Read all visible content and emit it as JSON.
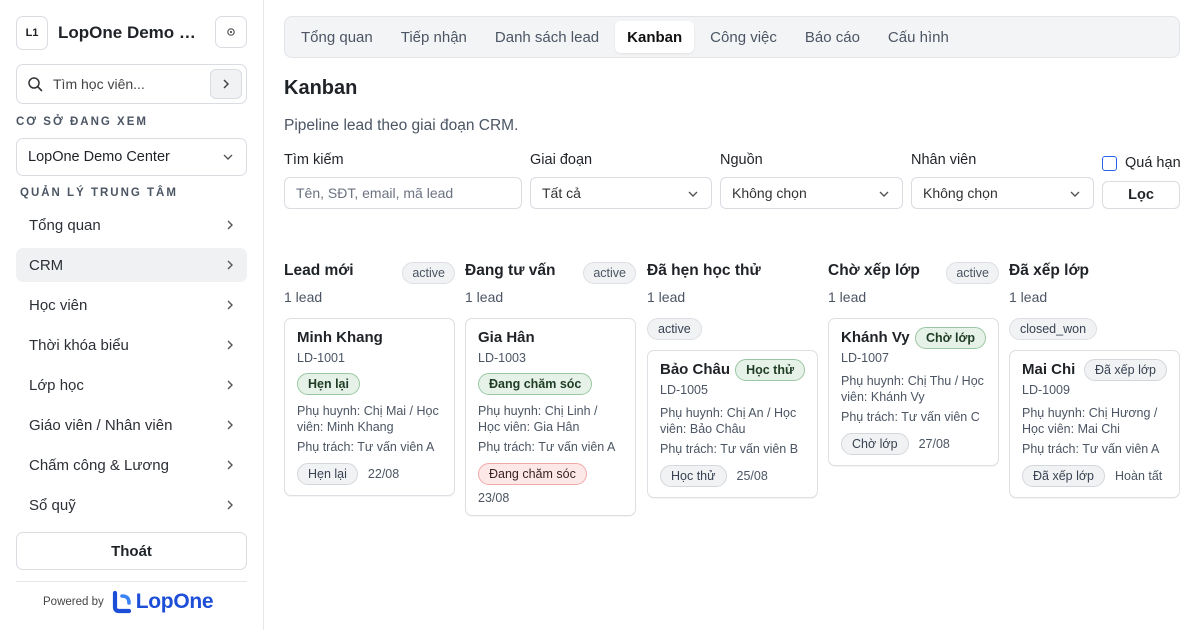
{
  "sidebar": {
    "logo_initials": "L1",
    "brand_name": "LopOne Demo Center",
    "search_placeholder": "Tìm học viên...",
    "center_section_label": "CƠ SỞ ĐANG XEM",
    "center_selected": "LopOne Demo Center",
    "manage_section_label": "QUẢN LÝ TRUNG TÂM",
    "nav_items": [
      {
        "label": "Tổng quan"
      },
      {
        "label": "CRM",
        "active": true
      },
      {
        "label": "Học viên"
      },
      {
        "label": "Thời khóa biểu"
      },
      {
        "label": "Lớp học"
      },
      {
        "label": "Giáo viên / Nhân viên"
      },
      {
        "label": "Chấm công & Lương"
      },
      {
        "label": "Sổ quỹ"
      }
    ],
    "logout_label": "Thoát",
    "powered_by": "Powered by",
    "powered_logo_text": "LopOne",
    "accent_color": "#1d4ed8"
  },
  "tabs": [
    {
      "label": "Tổng quan"
    },
    {
      "label": "Tiếp nhận"
    },
    {
      "label": "Danh sách lead"
    },
    {
      "label": "Kanban",
      "active": true
    },
    {
      "label": "Công việc"
    },
    {
      "label": "Báo cáo"
    },
    {
      "label": "Cấu hình"
    }
  ],
  "page": {
    "title": "Kanban",
    "subtitle": "Pipeline lead theo giai đoạn CRM."
  },
  "filters": {
    "search_label": "Tìm kiếm",
    "search_placeholder": "Tên, SĐT, email, mã lead",
    "stage_label": "Giai đoạn",
    "stage_value": "Tất cả",
    "source_label": "Nguồn",
    "source_value": "Không chọn",
    "staff_label": "Nhân viên",
    "staff_value": "Không chọn",
    "overdue_label": "Quá hạn",
    "overdue_checked": false,
    "filter_button": "Lọc"
  },
  "kanban": {
    "columns": [
      {
        "title": "Lead mới",
        "badge": "active",
        "count": "1 lead",
        "card": {
          "name": "Minh Khang",
          "code": "LD-1001",
          "status": "Hẹn lại",
          "parent": "Phụ huynh: Chị Mai / Học viên: Minh Khang",
          "owner": "Phụ trách: Tư vấn viên A",
          "foot_tag": "Hẹn lại",
          "foot_date": "22/08"
        }
      },
      {
        "title": "Đang tư vấn",
        "badge": "active",
        "count": "1 lead",
        "card": {
          "name": "Gia Hân",
          "code": "LD-1003",
          "status": "Đang chăm sóc",
          "parent": "Phụ huynh: Chị Linh / Học viên: Gia Hân",
          "owner": "Phụ trách: Tư vấn viên A",
          "foot_tag": "Đang chăm sóc",
          "foot_date": "23/08"
        }
      },
      {
        "title": "Đã hẹn học thử",
        "stage_pill": "active",
        "count": "1 lead",
        "card": {
          "name": "Bảo Châu",
          "code": "LD-1005",
          "status": "Học thử",
          "parent": "Phụ huynh: Chị An / Học viên: Bảo Châu",
          "owner": "Phụ trách: Tư vấn viên B",
          "foot_tag": "Học thử",
          "foot_date": "25/08"
        }
      },
      {
        "title": "Chờ xếp lớp",
        "badge": "active",
        "count": "1 lead",
        "card": {
          "name": "Khánh Vy",
          "code": "LD-1007",
          "status": "Chờ lớp",
          "parent": "Phụ huynh: Chị Thu / Học viên: Khánh Vy",
          "owner": "Phụ trách: Tư vấn viên C",
          "foot_tag": "Chờ lớp",
          "foot_date": "27/08"
        }
      },
      {
        "title": "Đã xếp lớp",
        "stage_pill": "closed_won",
        "count": "1 lead",
        "card": {
          "name": "Mai Chi",
          "code": "LD-1009",
          "status": "Đã xếp lớp",
          "parent": "Phụ huynh: Chị Hương / Học viên: Mai Chi",
          "owner": "Phụ trách: Tư vấn viên A",
          "foot_tag": "Đã xếp lớp",
          "foot_date": "Hoàn tất"
        }
      }
    ]
  }
}
